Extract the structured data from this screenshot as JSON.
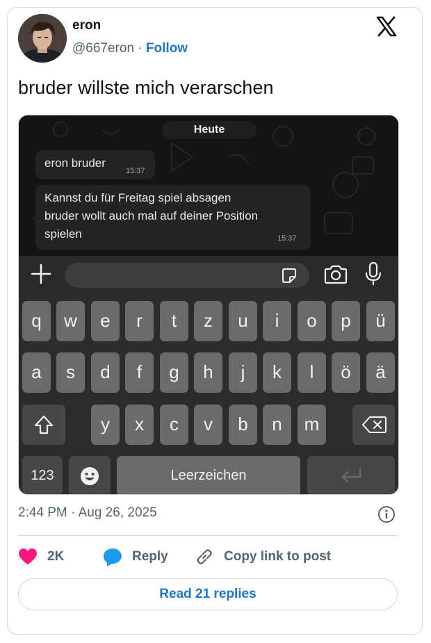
{
  "author": {
    "name": "eron",
    "handle": "@667eron",
    "separator": "·",
    "follow_label": "Follow"
  },
  "tweet": {
    "text": "bruder willste mich verarschen"
  },
  "screenshot": {
    "date_pill": "Heute",
    "messages": [
      {
        "text": "eron bruder",
        "time": "15:37"
      },
      {
        "lines": [
          "Kannst du für Freitag spiel absagen",
          "bruder wollt auch mal auf deiner Position",
          "spielen"
        ],
        "time": "15:37"
      }
    ],
    "keyboard": {
      "row1": [
        "q",
        "w",
        "e",
        "r",
        "t",
        "z",
        "u",
        "i",
        "o",
        "p",
        "ü"
      ],
      "row2": [
        "a",
        "s",
        "d",
        "f",
        "g",
        "h",
        "j",
        "k",
        "l",
        "ö",
        "ä"
      ],
      "row3": [
        "y",
        "x",
        "c",
        "v",
        "b",
        "n",
        "m"
      ],
      "numbers_label": "123",
      "space_label": "Leerzeichen"
    },
    "icons": [
      "plus-icon",
      "sticker-icon",
      "camera-icon",
      "microphone-icon",
      "shift-icon",
      "backspace-icon",
      "emoji-icon",
      "return-icon"
    ]
  },
  "meta": {
    "timestamp": "2:44 PM · Aug 26, 2025"
  },
  "actions": {
    "likes": "2K",
    "reply_label": "Reply",
    "copy_label": "Copy link to post"
  },
  "read_replies_label": "Read 21 replies",
  "colors": {
    "accent": "#1d74c9",
    "like": "#f91880",
    "reply": "#1d9bf0",
    "muted": "#536471"
  }
}
